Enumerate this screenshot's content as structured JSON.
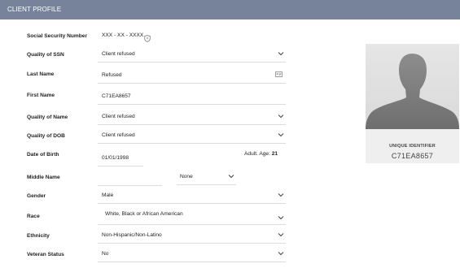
{
  "header": {
    "title": "CLIENT PROFILE"
  },
  "form": {
    "ssn": {
      "label": "Social Security Number",
      "value": "XXX - XX - XXXX"
    },
    "ssn_quality": {
      "label": "Quality of SSN",
      "value": "Client refused"
    },
    "last_name": {
      "label": "Last Name",
      "value": "Refused"
    },
    "first_name": {
      "label": "First Name",
      "value": "C71EA8657"
    },
    "name_quality": {
      "label": "Quality of Name",
      "value": "Client refused"
    },
    "dob_quality": {
      "label": "Quality of DOB",
      "value": "Client refused"
    },
    "dob": {
      "label": "Date of Birth",
      "value": "01/01/1998",
      "age_prefix": "Adult. Age:",
      "age": "21"
    },
    "middle_name": {
      "label": "Middle Name",
      "value": "",
      "suffix_value": "None"
    },
    "gender": {
      "label": "Gender",
      "value": "Male"
    },
    "race": {
      "label": "Race",
      "value": "White, Black or African American"
    },
    "ethnicity": {
      "label": "Ethnicity",
      "value": "Non-Hispanic/Non-Latino"
    },
    "veteran": {
      "label": "Veteran Status",
      "value": "No"
    }
  },
  "profile_card": {
    "uid_label": "UNIQUE IDENTIFIER",
    "uid_value": "C71EA8657"
  },
  "icons": [
    "shield-icon",
    "id-card-icon",
    "chevron-down-icon",
    "avatar-silhouette-icon"
  ]
}
